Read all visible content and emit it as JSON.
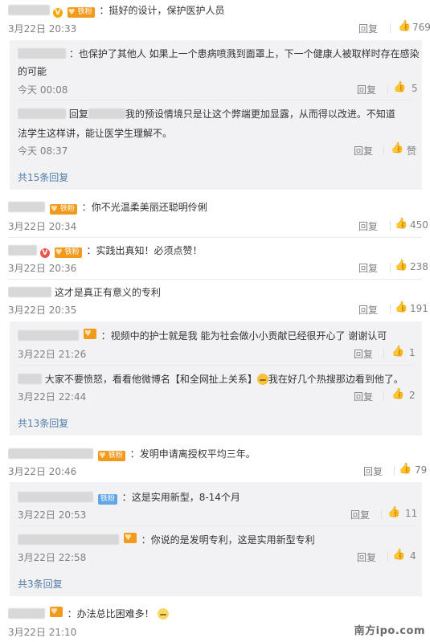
{
  "comments": [
    {
      "text": "挺好的设计，保护医护人员",
      "time": "3月22日 20:33",
      "reply": "回复",
      "likes": "769",
      "badge": "铁粉"
    },
    {
      "text": "也保护了其他人 如果上一个患病喷溅到面罩上，下一个健康人被取样时存在感染",
      "text2": "的可能",
      "time": "今天 00:08",
      "reply": "回复",
      "likes": "5"
    },
    {
      "reply_word": "回复",
      "text": "我的预设情境只是让这个弊端更加显露，从而得以改进。不知道",
      "text2": "法学生这样讲，能让医学生理解不。",
      "time": "今天 08:37",
      "reply": "回复",
      "likes": "赞"
    },
    {
      "more": "共15条回复"
    },
    {
      "text": "你不光温柔美丽还聪明伶俐",
      "time": "3月22日 20:34",
      "reply": "回复",
      "likes": "450",
      "badge": "铁粉"
    },
    {
      "text": "实践出真知！必须点赞！",
      "time": "3月22日 20:36",
      "reply": "回复",
      "likes": "238",
      "badge": "铁粉"
    },
    {
      "text": "这才是真正有意义的专利",
      "time": "3月22日 20:35",
      "reply": "回复",
      "likes": "191"
    },
    {
      "text": "视频中的护士就是我 能为社会做小小贡献已经很开心了 谢谢认可",
      "time": "3月22日 21:26",
      "reply": "回复",
      "likes": "1"
    },
    {
      "text": "大家不要愤怒，看看他微博名【和全网扯上关系】",
      "text_after": "我在好几个热搜那边看到他了。",
      "time": "3月22日 22:44",
      "reply": "回复",
      "likes": "2"
    },
    {
      "more": "共13条回复"
    },
    {
      "text": "发明申请离授权平均三年。",
      "time": "3月22日 20:46",
      "reply": "回复",
      "likes": "79",
      "badge": "铁粉"
    },
    {
      "text": "这是实用新型，8-14个月",
      "time": "3月22日 20:53",
      "reply": "回复",
      "likes": "11",
      "badge": "铁粉"
    },
    {
      "text": "你说的是发明专利，这是实用新型专利",
      "time": "3月22日 22:58",
      "reply": "回复",
      "likes": "4"
    },
    {
      "more": "共3条回复"
    },
    {
      "text": "办法总比困难多！",
      "time": "3月22日 21:10"
    }
  ],
  "watermark": "南方ipo.com",
  "colors": {
    "link": "#507ca6",
    "meta": "#808080",
    "badge": "#f29a1b",
    "subbg": "#f2f2f5"
  },
  "icons": {
    "like": "thumb-up-icon",
    "verified": "v-badge-icon",
    "emoji": "emoji-icon"
  }
}
